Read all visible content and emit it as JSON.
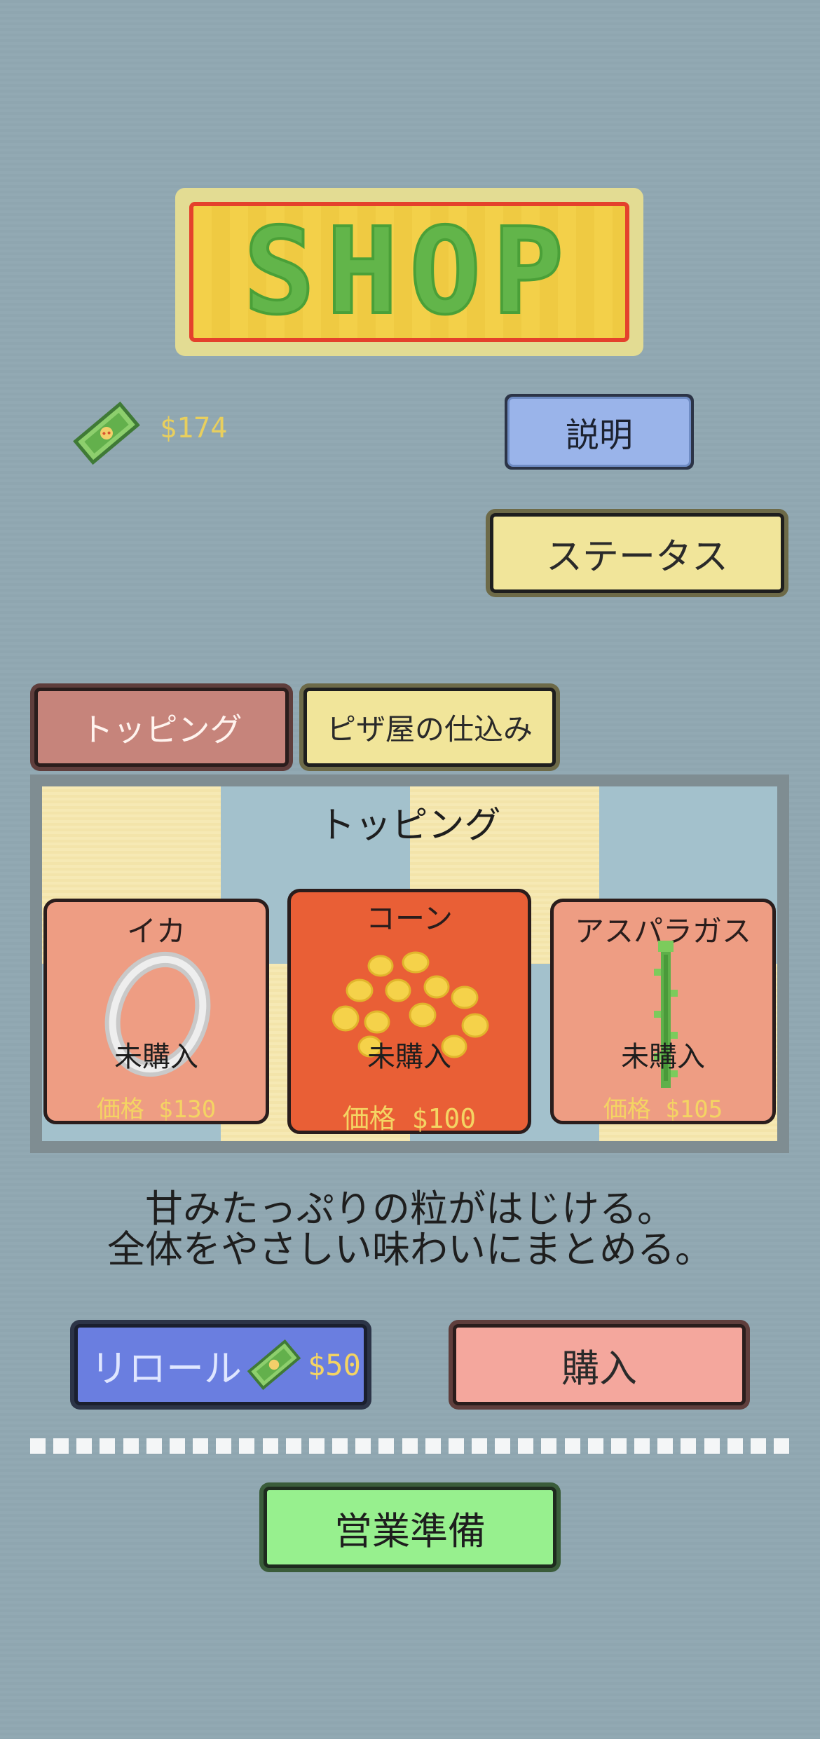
{
  "shop_logo": {
    "text": "SHOP"
  },
  "money": {
    "amount": "$174"
  },
  "buttons": {
    "explain": "説明",
    "status": "ステータス",
    "reroll": "リロール",
    "reroll_price": "$50",
    "buy": "購入",
    "prepare": "営業準備"
  },
  "tabs": [
    {
      "label": "トッピング",
      "active": true
    },
    {
      "label": "ピザ屋の仕込み",
      "active": false
    }
  ],
  "panel": {
    "title": "トッピング",
    "items": [
      {
        "name": "イカ",
        "status": "未購入",
        "price": "価格 $130",
        "selected": false
      },
      {
        "name": "コーン",
        "status": "未購入",
        "price": "価格 $100",
        "selected": true
      },
      {
        "name": "アスパラガス",
        "status": "未購入",
        "price": "価格 $105",
        "selected": false
      }
    ]
  },
  "description": {
    "line1": "甘みたっぷりの粒がはじける。",
    "line2": "全体をやさしい味わいにまとめる。"
  },
  "colors": {
    "background": "#8fa6b0",
    "money_text": "#e8cf5e",
    "selected_card": "#e95f36",
    "card": "#ee9d83"
  },
  "icons": {
    "money": "money-bill-icon",
    "squid": "squid-ring-icon",
    "corn": "corn-kernels-icon",
    "asparagus": "asparagus-icon"
  }
}
